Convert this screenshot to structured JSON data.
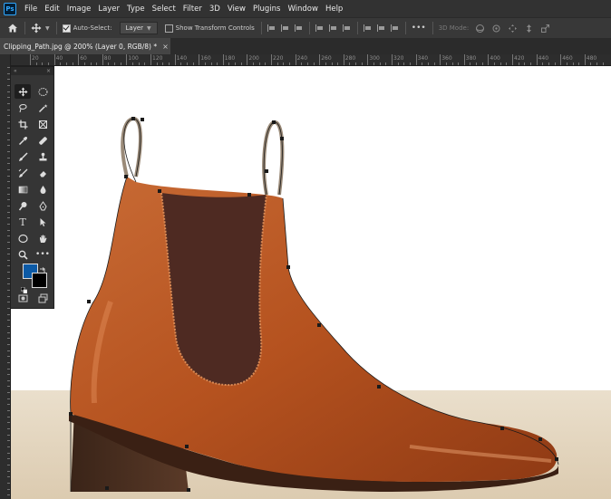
{
  "menubar": {
    "logo": "Ps",
    "items": [
      "File",
      "Edit",
      "Image",
      "Layer",
      "Type",
      "Select",
      "Filter",
      "3D",
      "View",
      "Plugins",
      "Window",
      "Help"
    ]
  },
  "options": {
    "auto_select_label": "Auto-Select:",
    "auto_select_value": "Layer",
    "show_transform_label": "Show Transform Controls",
    "mode_label": "3D Mode:",
    "more_label": "•••"
  },
  "document": {
    "tab_title": "Clipping_Path.jpg @ 200% (Layer 0, RGB/8) *",
    "close_glyph": "×"
  },
  "ruler": {
    "top_labels": [
      "20",
      "40",
      "60",
      "80",
      "100",
      "120",
      "140",
      "160",
      "180",
      "200",
      "220",
      "240",
      "260",
      "280",
      "300",
      "320",
      "340",
      "360",
      "380",
      "400",
      "420",
      "440",
      "460",
      "480"
    ]
  },
  "toolbox": {
    "collapse_glyph": "«",
    "close_glyph": "×",
    "type_tool_glyph": "T",
    "more_tools_glyph": "•••"
  },
  "colors": {
    "foreground": "#0c5aa6",
    "background": "#000000",
    "boot_leather": "#b5521f",
    "boot_elastic": "#4e2a22"
  },
  "icons": [
    "home-icon",
    "move-tool-icon",
    "marquee-icon",
    "lasso-icon",
    "magic-wand-icon",
    "crop-icon",
    "frame-icon",
    "eyedropper-icon",
    "healing-brush-icon",
    "brush-icon",
    "stamp-icon",
    "history-brush-icon",
    "eraser-icon",
    "gradient-icon",
    "blur-icon",
    "dodge-icon",
    "pen-icon",
    "type-icon",
    "path-select-icon",
    "shape-icon",
    "hand-icon",
    "zoom-icon",
    "more-tools-icon"
  ]
}
